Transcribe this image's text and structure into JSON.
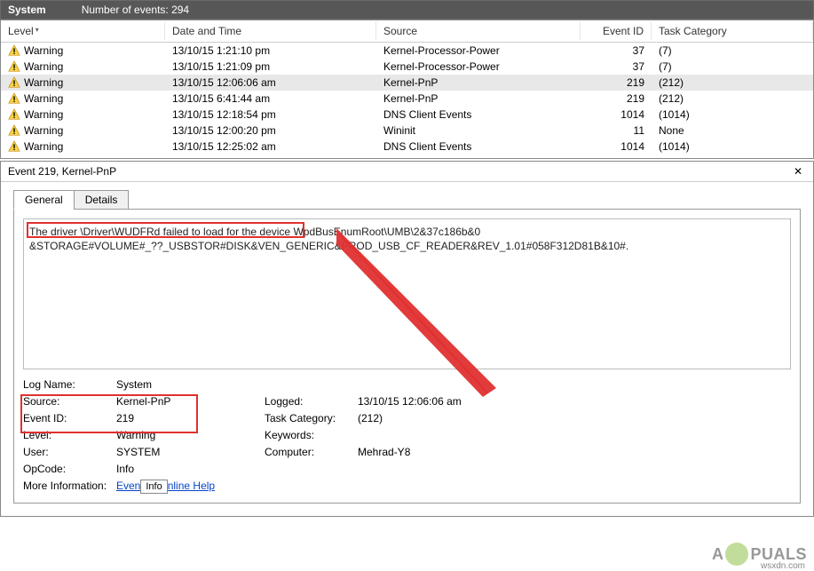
{
  "header": {
    "label": "System",
    "events_text": "Number of events: 294"
  },
  "columns": {
    "level": "Level",
    "date": "Date and Time",
    "source": "Source",
    "event_id": "Event ID",
    "task": "Task Category"
  },
  "rows": [
    {
      "level": "Warning",
      "date": "13/10/15 1:21:10 pm",
      "source": "Kernel-Processor-Power",
      "id": "37",
      "task": "(7)"
    },
    {
      "level": "Warning",
      "date": "13/10/15 1:21:09 pm",
      "source": "Kernel-Processor-Power",
      "id": "37",
      "task": "(7)"
    },
    {
      "level": "Warning",
      "date": "13/10/15 12:06:06 am",
      "source": "Kernel-PnP",
      "id": "219",
      "task": "(212)",
      "selected": true
    },
    {
      "level": "Warning",
      "date": "13/10/15 6:41:44 am",
      "source": "Kernel-PnP",
      "id": "219",
      "task": "(212)"
    },
    {
      "level": "Warning",
      "date": "13/10/15 12:18:54 pm",
      "source": "DNS Client Events",
      "id": "1014",
      "task": "(1014)"
    },
    {
      "level": "Warning",
      "date": "13/10/15 12:00:20 pm",
      "source": "Wininit",
      "id": "11",
      "task": "None"
    },
    {
      "level": "Warning",
      "date": "13/10/15 12:25:02 am",
      "source": "DNS Client Events",
      "id": "1014",
      "task": "(1014)"
    }
  ],
  "detail": {
    "title": "Event 219, Kernel-PnP",
    "tabs": {
      "general": "General",
      "details": "Details"
    },
    "description_line1": "The driver \\Driver\\WUDFRd failed to load for the device WpdBusEnumRoot\\UMB\\2&37c186b&0",
    "description_line1_hl": "The driver \\Driver\\WUDFRd failed to load for the device ",
    "description_line1_rest": "WpdBusEnumRoot\\UMB\\2&37c186b&0",
    "description_line2": "&STORAGE#VOLUME#_??_USBSTOR#DISK&VEN_GENERIC&PROD_USB_CF_READER&REV_1.01#058F312D81B&10#.",
    "labels": {
      "log_name": "Log Name:",
      "source": "Source:",
      "event_id": "Event ID:",
      "level": "Level:",
      "user": "User:",
      "opcode": "OpCode:",
      "more_info": "More Information:",
      "logged": "Logged:",
      "task_cat": "Task Category:",
      "keywords": "Keywords:",
      "computer": "Computer:"
    },
    "values": {
      "log_name": "System",
      "source": "Kernel-PnP",
      "event_id": "219",
      "level": "Warning",
      "user": "SYSTEM",
      "opcode": "Info",
      "logged": "13/10/15 12:06:06 am",
      "task_cat": "(212)",
      "keywords": "",
      "computer": "Mehrad-Y8"
    },
    "more_link_pre": "Even",
    "tooltip": "Info",
    "more_link_post": "nline Help"
  },
  "watermark": {
    "pre": "A",
    "post": "PUALS"
  },
  "wsxdn": "wsxdn.com"
}
